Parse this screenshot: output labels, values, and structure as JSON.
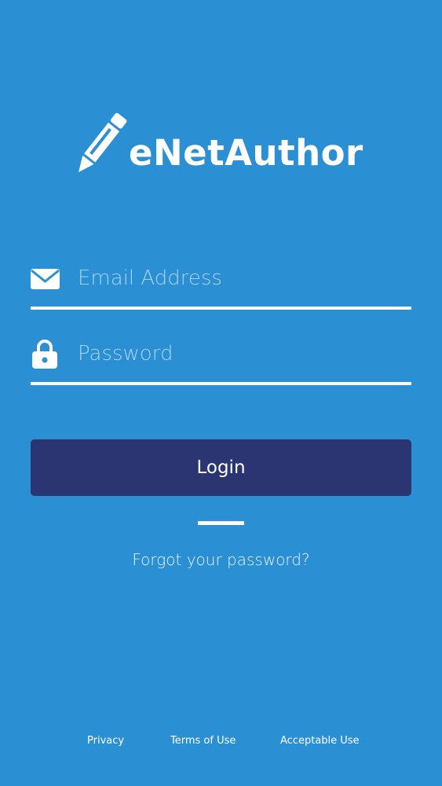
{
  "app": {
    "name": "eNetAuthor",
    "logo_icon": "pencil-icon"
  },
  "form": {
    "email": {
      "icon": "envelope-icon",
      "placeholder": "Email Address",
      "value": ""
    },
    "password": {
      "icon": "lock-icon",
      "placeholder": "Password",
      "value": ""
    },
    "login_label": "Login",
    "forgot_label": "Forgot your password?"
  },
  "footer": {
    "links": [
      "Privacy",
      "Terms of Use",
      "Acceptable Use"
    ]
  },
  "colors": {
    "background": "#2b8fd4",
    "button": "#2b3571",
    "text": "#ffffff",
    "placeholder": "#a9d3f2"
  }
}
